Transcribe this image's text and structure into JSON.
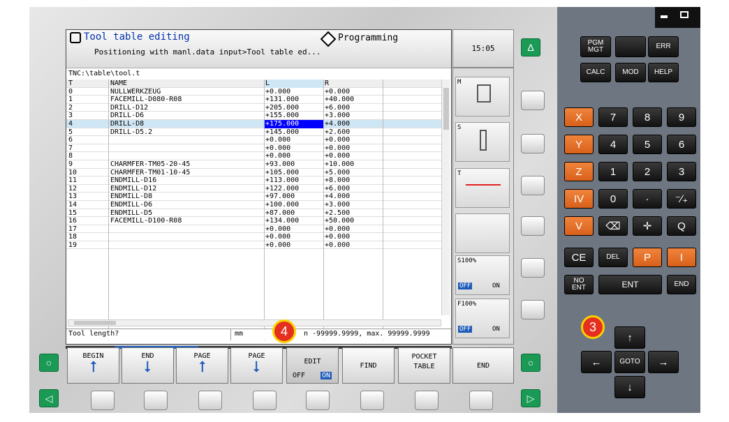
{
  "window": {
    "title": "Tool table editing",
    "subtitle": "Positioning with manl.data input>Tool table ed...",
    "mode": "Programming",
    "time": "15:05"
  },
  "path": "TNC:\\table\\tool.t",
  "columns": [
    "T",
    "NAME",
    "L",
    "R"
  ],
  "rows": [
    [
      "0",
      "NULLWERKZEUG",
      "+0.000",
      "+0.000"
    ],
    [
      "1",
      "FACEMILL-D080-R08",
      "+131.000",
      "+40.000"
    ],
    [
      "2",
      "DRILL-D12",
      "+205.000",
      "+6.000"
    ],
    [
      "3",
      "DRILL-D6",
      "+155.000",
      "+3.000"
    ],
    [
      "4",
      "DRILL-D8",
      "+175.000",
      "+4.000"
    ],
    [
      "5",
      "DRILL-D5.2",
      "+145.000",
      "+2.600"
    ],
    [
      "6",
      "",
      "+0.000",
      "+0.000"
    ],
    [
      "7",
      "",
      "+0.000",
      "+0.000"
    ],
    [
      "8",
      "",
      "+0.000",
      "+0.000"
    ],
    [
      "9",
      "CHARMFER-TM05-20-45",
      "+93.000",
      "+10.000"
    ],
    [
      "10",
      "CHARMFER-TM01-10-45",
      "+105.000",
      "+5.000"
    ],
    [
      "11",
      "ENDMILL-D16",
      "+113.000",
      "+8.000"
    ],
    [
      "12",
      "ENDMILL-D12",
      "+122.000",
      "+6.000"
    ],
    [
      "13",
      "ENDMILL-D8",
      "+97.000",
      "+4.000"
    ],
    [
      "14",
      "ENDMILL-D6",
      "+100.000",
      "+3.000"
    ],
    [
      "15",
      "ENDMILL-D5",
      "+87.000",
      "+2.500"
    ],
    [
      "16",
      "FACEMILL-D100-R08",
      "+134.000",
      "+50.000"
    ],
    [
      "17",
      "",
      "+0.000",
      "+0.000"
    ],
    [
      "18",
      "",
      "+0.000",
      "+0.000"
    ],
    [
      "19",
      "",
      "+0.000",
      "+0.000"
    ]
  ],
  "status": {
    "prompt": "Tool length?",
    "unit": "mm",
    "range": "n -99999.9999, max. 99999.9999"
  },
  "side": {
    "m": "M",
    "s": "S",
    "t": "T",
    "s_override": "S100%",
    "f_override": "F100%",
    "off": "OFF",
    "on": "ON"
  },
  "softkeys": [
    {
      "label": "BEGIN"
    },
    {
      "label": "END"
    },
    {
      "label": "PAGE"
    },
    {
      "label": "PAGE"
    },
    {
      "label": "EDIT",
      "off": "OFF",
      "on": "ON"
    },
    {
      "label": "FIND"
    },
    {
      "label": "POCKET\nTABLE"
    },
    {
      "label": "END"
    }
  ],
  "keys": {
    "pgm": "PGM\nMGT",
    "err": "ERR",
    "calc": "CALC",
    "mod": "MOD",
    "help": "HELP",
    "x": "X",
    "y": "Y",
    "z": "Z",
    "iv": "IV",
    "v": "V",
    "n7": "7",
    "n8": "8",
    "n9": "9",
    "n4": "4",
    "n5": "5",
    "n6": "6",
    "n1": "1",
    "n2": "2",
    "n3": "3",
    "n0": "0",
    "dot": "·",
    "pm": "⁻∕₊",
    "q": "Q",
    "ce": "CE",
    "del": "DEL",
    "p": "P",
    "i": "I",
    "noent": "NO\nENT",
    "ent": "ENT",
    "endk": "END",
    "goto": "GOTO"
  },
  "markers": {
    "m3": "3",
    "m4": "4"
  },
  "colors": {
    "selection": "#0000ff",
    "accent_green": "#1a9a55",
    "orange": "#e0702a",
    "badge": "#e53020"
  }
}
